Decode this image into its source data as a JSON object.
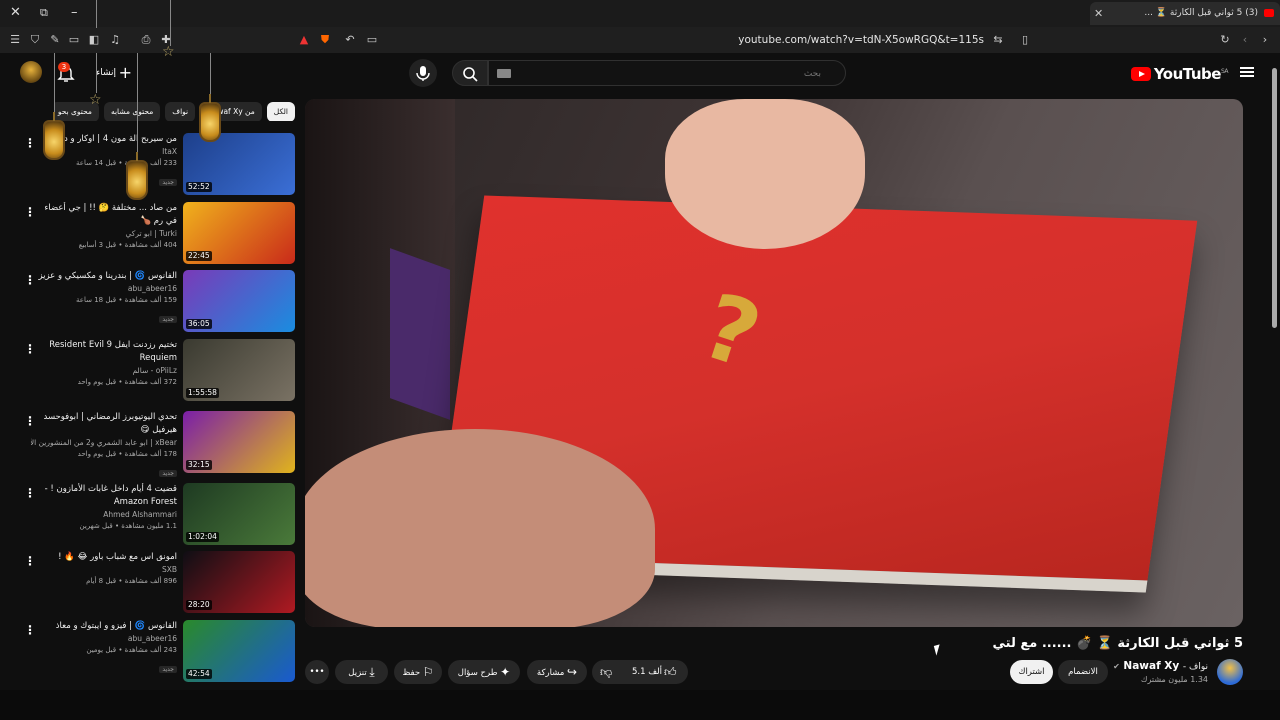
{
  "browser": {
    "tab_title": "(3) 5 ثواني قبل الكارثة ⏳ ...",
    "url": "youtube.com/watch?v=tdN-X5owRGQ&t=115s"
  },
  "header": {
    "logo": "YouTube",
    "logo_region": "SA",
    "search_placeholder": "بحث",
    "create_label": "إنشاء",
    "notification_count": "3"
  },
  "video": {
    "title": "5 ثواني قبل الكارثة ⏳ 💣 ...... مع لتي",
    "channel_name": "Nawaf Xy",
    "channel_prefix": "نواف -",
    "subscribers": "1.34 مليون مشترك",
    "join_label": "الانضمام",
    "subscribe_label": "اشتراك",
    "likes": "5.1 ألف",
    "share_label": "مشاركة",
    "ask_label": "طرح سؤال",
    "save_label": "حفظ",
    "download_label": "تنزيل",
    "more_label": "•••"
  },
  "chips": [
    "الكل",
    "من Nawaf Xy",
    "نواف",
    "محتوى مشابه",
    "محتوى بحو"
  ],
  "recommendations": [
    {
      "title": "من سيربح الة مون 4 | اوكار و دريحة",
      "channel": "ItaX",
      "meta": "233 ألف مشاهدة • قبل 14 ساعة",
      "duration": "52:52",
      "new": "جديد",
      "colors": [
        "#1d3f8a",
        "#3b6fd6"
      ]
    },
    {
      "title": "من صاد ... مختلفة 🤔 !! | جي أعضاء في رم 🍗",
      "channel": "Turki | ابو تركي",
      "meta": "404 ألف مشاهدة • قبل 3 أسابيع",
      "duration": "22:45",
      "new": "",
      "colors": [
        "#f0b21c",
        "#c92a1a"
      ]
    },
    {
      "title": "الفانوس 🌀 | بندرينا و مكسيكي و عزيز",
      "channel": "abu_abeer16",
      "meta": "159 ألف مشاهدة • قبل 18 ساعة",
      "duration": "36:05",
      "new": "جديد",
      "colors": [
        "#7a3ab8",
        "#1a8de0"
      ]
    },
    {
      "title": "تختيم رزدنت ايفل Resident Evil 9 Requiem",
      "channel": "oPiiLz - سالم",
      "meta": "372 ألف مشاهدة • قبل يوم واحد",
      "duration": "1:55:58",
      "new": "",
      "colors": [
        "#3a3a30",
        "#7a7264"
      ]
    },
    {
      "title": "تحدي اليوتيوبرز الرمضاني | ابوفوحسد هيرفيل 😋",
      "channel": "xBear | ابو عابد الشمري و2 من المنشورين الآخرين",
      "meta": "178 ألف مشاهدة • قبل يوم واحد",
      "duration": "32:15",
      "new": "جديد",
      "colors": [
        "#7a1ea8",
        "#e0b41c"
      ]
    },
    {
      "title": "قضيت 4 أيام داخل غابات الأمازون ! - Amazon Forest",
      "channel": "Ahmed Alshammari",
      "meta": "1.1 مليون مشاهدة • قبل شهرين",
      "duration": "1:02:04",
      "new": "",
      "colors": [
        "#1e3a22",
        "#4a7a3a"
      ]
    },
    {
      "title": "امونق اس مع شباب باور 😂 🔥 !",
      "channel": "SXB",
      "meta": "896 ألف مشاهدة • قبل 8 أيام",
      "duration": "28:20",
      "new": "",
      "colors": [
        "#0e0e14",
        "#b01a22"
      ]
    },
    {
      "title": "الفانوس 🌀 | فيزو و ايبتوك و معاذ",
      "channel": "abu_abeer16",
      "meta": "243 ألف مشاهدة • قبل يومين",
      "duration": "42:54",
      "new": "جديد",
      "colors": [
        "#2a8a2a",
        "#1a5ad0"
      ]
    }
  ]
}
